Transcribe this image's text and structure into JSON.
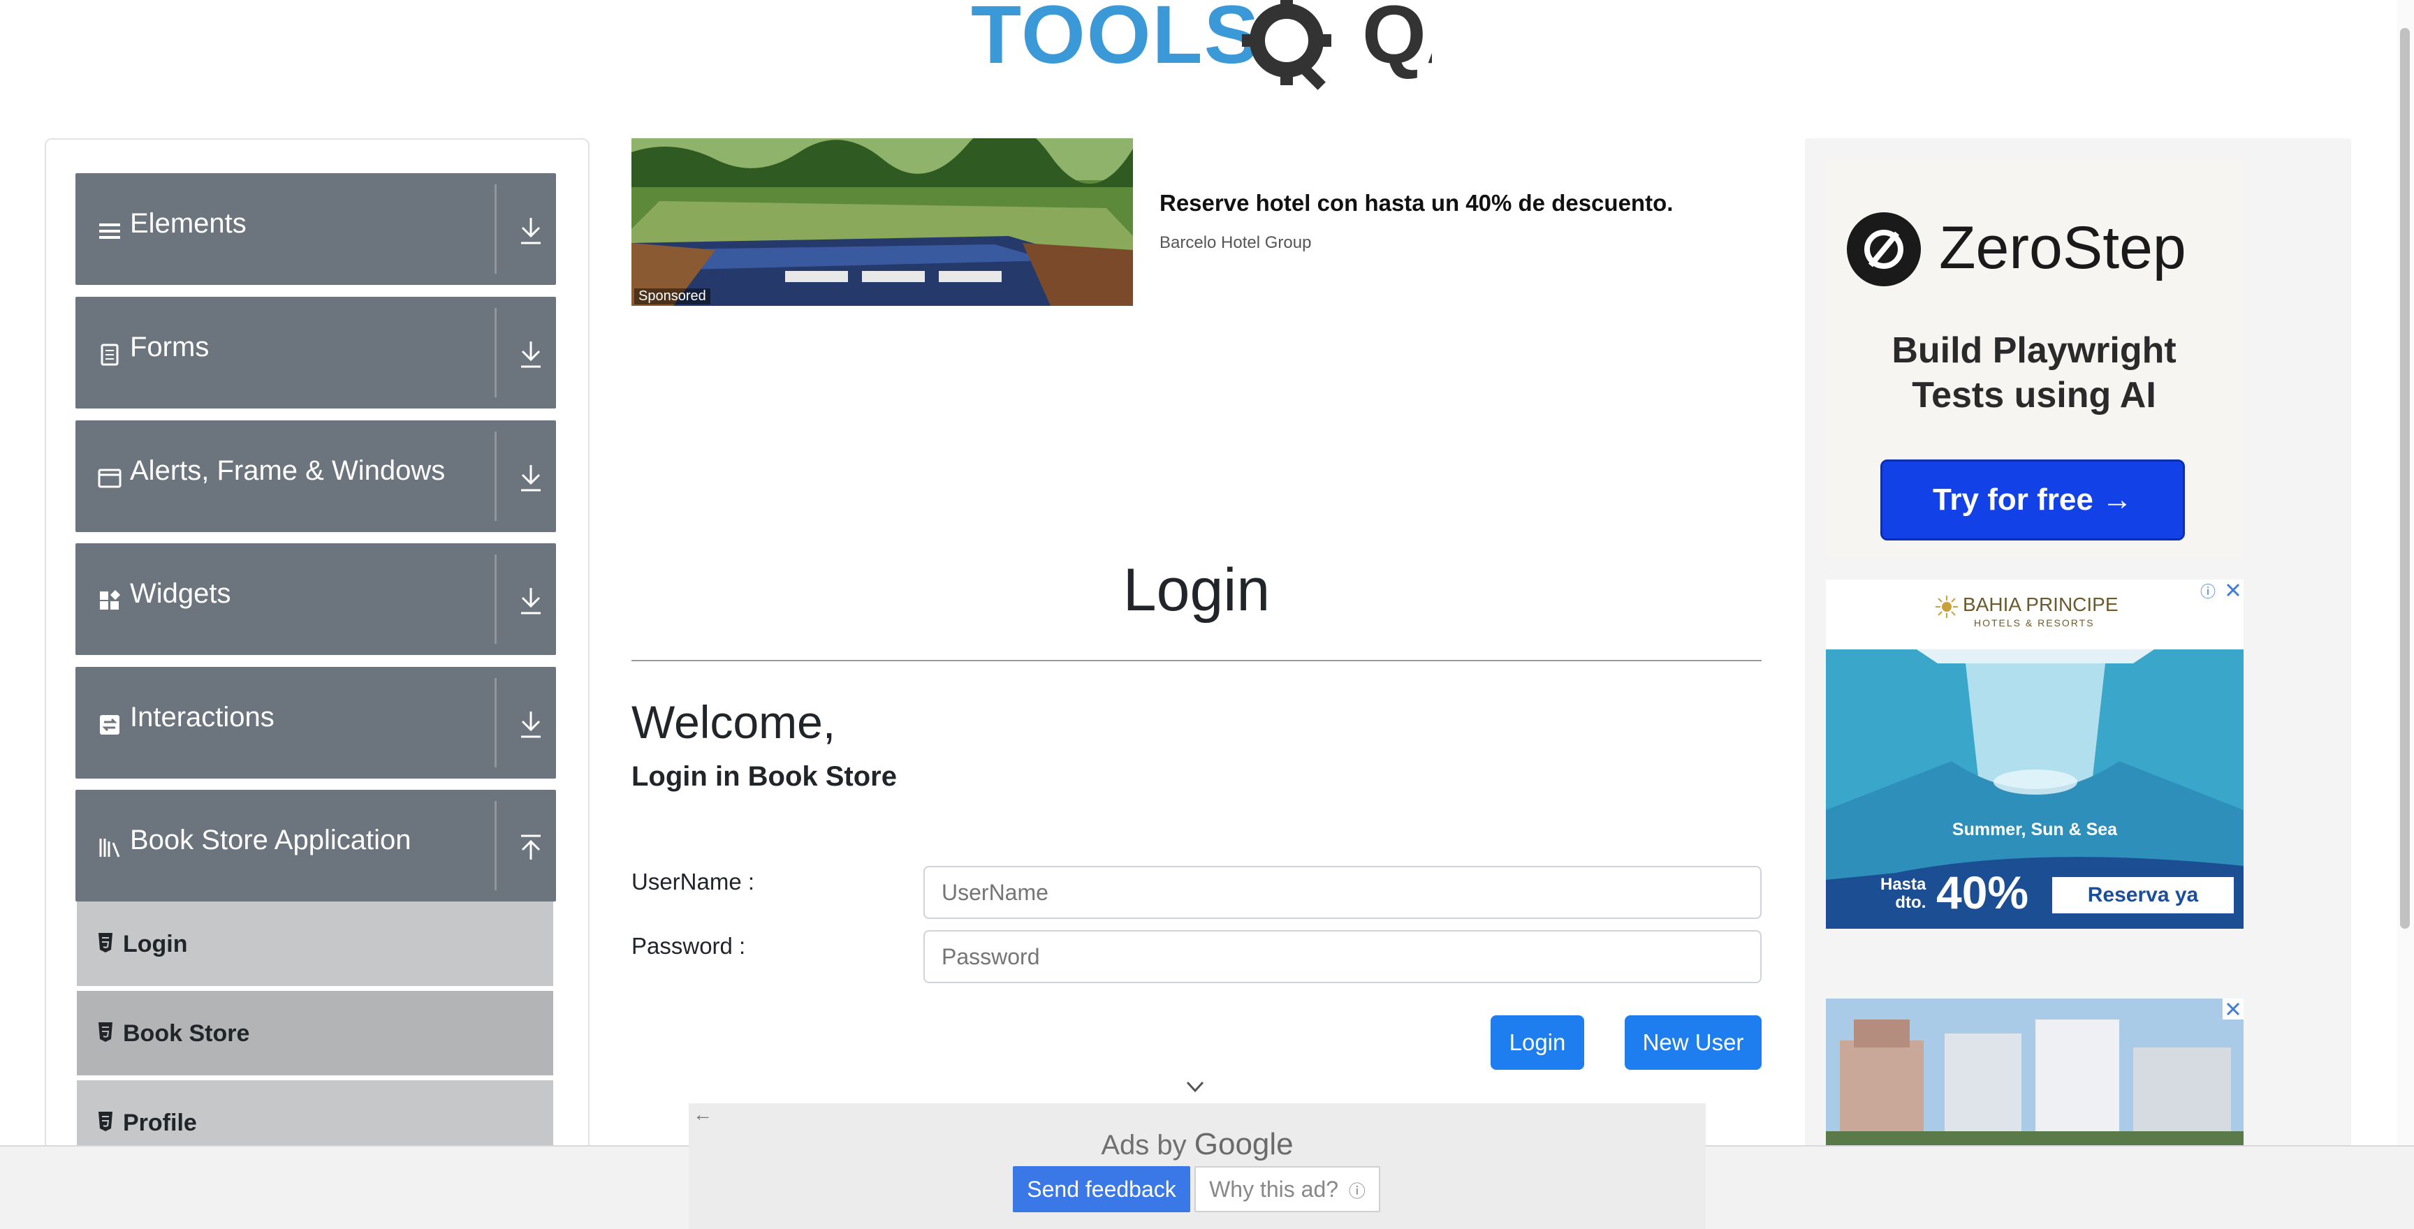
{
  "logo": {
    "text_tools": "TOOLS",
    "text_qa": "QA"
  },
  "sidebar": {
    "groups": [
      {
        "label": "Elements",
        "icon": "menu-icon",
        "expanded": false
      },
      {
        "label": "Forms",
        "icon": "document-icon",
        "expanded": false
      },
      {
        "label": "Alerts, Frame & Windows",
        "icon": "window-icon",
        "expanded": false
      },
      {
        "label": "Widgets",
        "icon": "widgets-icon",
        "expanded": false
      },
      {
        "label": "Interactions",
        "icon": "swap-icon",
        "expanded": false
      },
      {
        "label": "Book Store Application",
        "icon": "books-icon",
        "expanded": true
      }
    ],
    "subitems": [
      {
        "label": "Login",
        "active": false
      },
      {
        "label": "Book Store",
        "active": true
      },
      {
        "label": "Profile",
        "active": false
      }
    ]
  },
  "top_ad": {
    "sponsored": "Sponsored",
    "title": "Reserve hotel con hasta un 40% de descuento.",
    "advertiser": "Barcelo Hotel Group"
  },
  "main": {
    "title": "Login",
    "welcome": "Welcome,",
    "subheading": "Login in Book Store",
    "username_label": "UserName :",
    "username_placeholder": "UserName",
    "password_label": "Password :",
    "password_placeholder": "Password",
    "login_button": "Login",
    "new_user_button": "New User"
  },
  "right_ads": {
    "zerostep": {
      "brand": "ZeroStep",
      "tagline_line1": "Build Playwright",
      "tagline_line2": "Tests using AI",
      "cta": "Try for free →"
    },
    "bahia": {
      "brand": "BAHIA PRINCIPE",
      "brand_sub": "HOTELS & RESORTS",
      "tagline": "Summer, Sun & Sea",
      "hasta_line1": "Hasta",
      "hasta_line2": "dto.",
      "percent": "40%",
      "cta": "Reserva ya"
    }
  },
  "ads_overlay": {
    "ads_by": "Ads by",
    "google": "Google",
    "send_feedback": "Send feedback",
    "why_this_ad": "Why this ad?"
  },
  "colors": {
    "sidebar_group_bg": "#6c757d",
    "sidebar_subitem_bg": "#c6c7c8",
    "primary_button": "#1e7ef0",
    "logo_blue": "#3c99d8",
    "logo_dark": "#333333",
    "zerostep_cta": "#1241e8"
  }
}
